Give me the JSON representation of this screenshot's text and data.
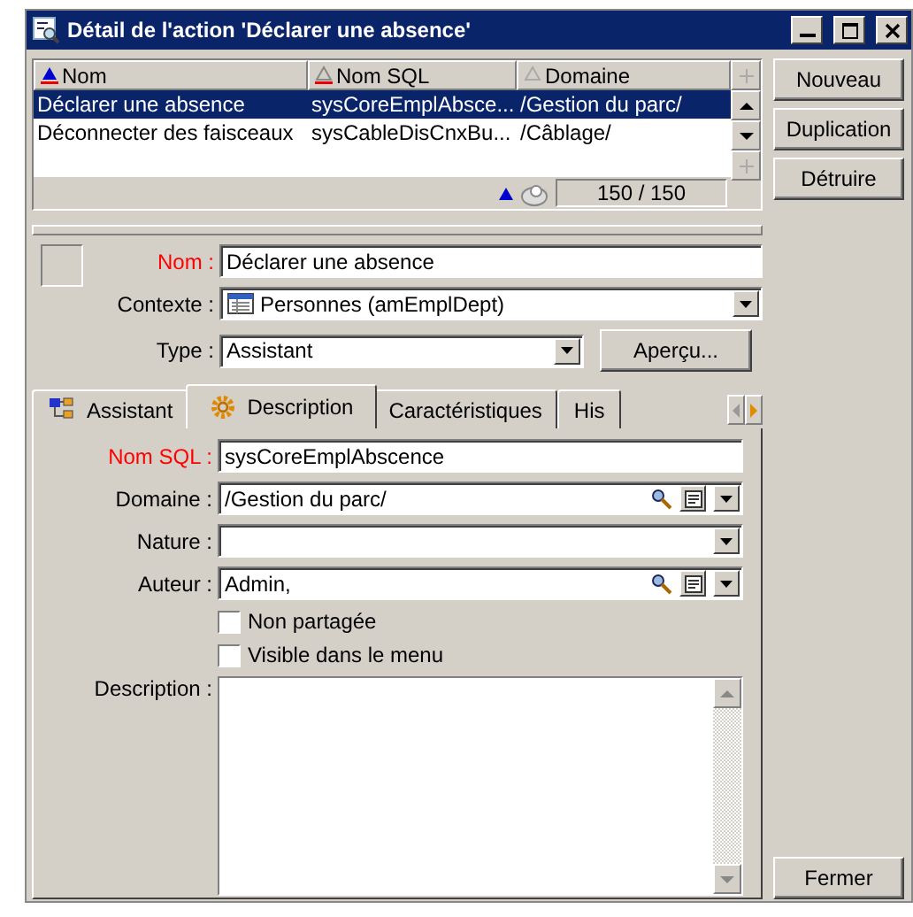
{
  "window": {
    "title": "Détail de l'action 'Déclarer une absence'"
  },
  "list": {
    "columns": [
      {
        "label": "Nom",
        "kind": "primary"
      },
      {
        "label": "Nom SQL",
        "kind": "secondary"
      },
      {
        "label": "Domaine",
        "kind": "plain"
      }
    ],
    "rows": [
      {
        "cells": [
          "Déclarer une absence",
          "sysCoreEmplAbsce...",
          "/Gestion du parc/"
        ],
        "selected": true
      },
      {
        "cells": [
          "Déconnecter des faisceaux",
          "sysCableDisCnxBu...",
          "/Câblage/"
        ],
        "selected": false
      }
    ],
    "count": "150 / 150"
  },
  "side_buttons": [
    "Nouveau",
    "Duplication",
    "Détruire"
  ],
  "header_fields": [
    {
      "label": "Nom :",
      "value": "Déclarer une absence",
      "required": true,
      "kind": "text"
    },
    {
      "label": "Contexte :",
      "value": "Personnes (amEmplDept)",
      "required": false,
      "kind": "table-combo"
    },
    {
      "label": "Type :",
      "value": "Assistant",
      "required": false,
      "kind": "combo"
    }
  ],
  "preview_button": "Aperçu...",
  "tabs": [
    {
      "label": "Assistant",
      "selected": false,
      "kind": "diagram"
    },
    {
      "label": "Description",
      "selected": true,
      "kind": "gear"
    },
    {
      "label": "Caractéristiques",
      "selected": false,
      "kind": "plain"
    },
    {
      "label": "His",
      "selected": false,
      "kind": "plain"
    }
  ],
  "tab_fields": [
    {
      "label": "Nom SQL :",
      "value": "sysCoreEmplAbscence",
      "required": true,
      "kind": "text"
    },
    {
      "label": "Domaine :",
      "value": "/Gestion du parc/",
      "required": false,
      "kind": "lookup"
    },
    {
      "label": "Nature :",
      "required": false,
      "kind": "combo"
    },
    {
      "label": "Auteur :",
      "value": "Admin,",
      "required": false,
      "kind": "lookup"
    }
  ],
  "checkboxes": [
    {
      "label": "Non partagée",
      "checked": false
    },
    {
      "label": "Visible dans le menu",
      "checked": false
    }
  ],
  "description": {
    "label": "Description :"
  },
  "close_button": "Fermer"
}
